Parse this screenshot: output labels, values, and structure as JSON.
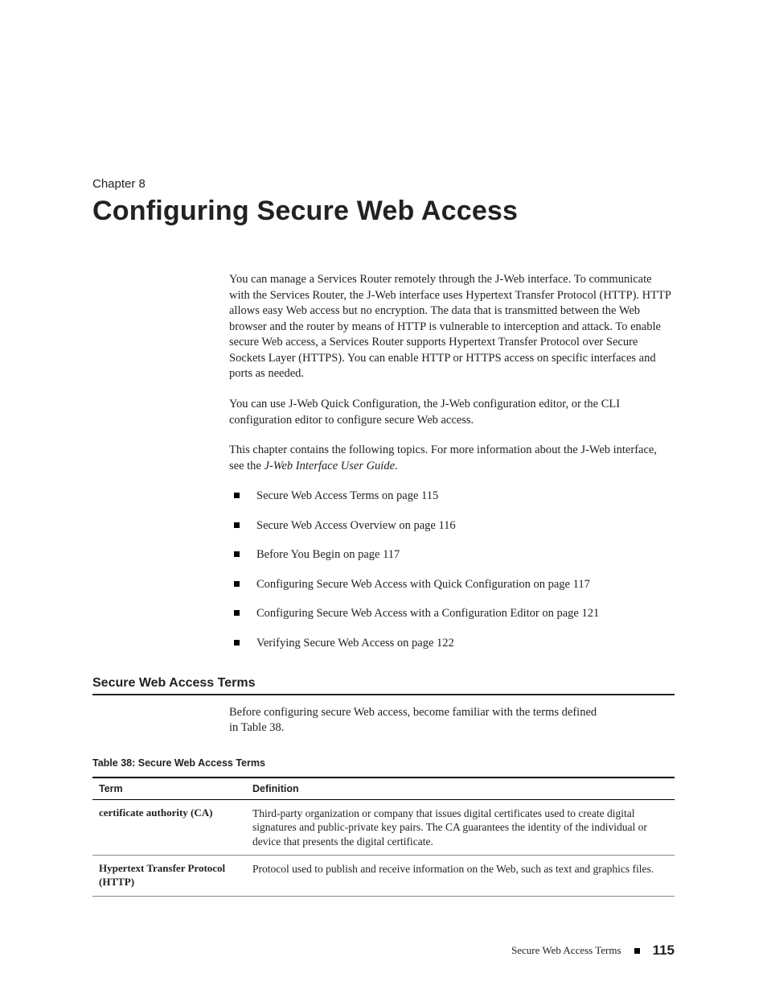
{
  "chapter": {
    "label": "Chapter 8",
    "title": "Configuring Secure Web Access"
  },
  "intro": {
    "p1": "You can manage a Services Router remotely through the J-Web interface. To communicate with the Services Router, the J-Web interface uses Hypertext Transfer Protocol (HTTP). HTTP allows easy Web access but no encryption. The data that is transmitted between the Web browser and the router by means of HTTP is vulnerable to interception and attack. To enable secure Web access, a Services Router supports Hypertext Transfer Protocol over Secure Sockets Layer (HTTPS). You can enable HTTP or HTTPS access on specific interfaces and ports as needed.",
    "p2": "You can use J-Web Quick Configuration, the J-Web configuration editor, or the CLI configuration editor to configure secure Web access.",
    "p3a": "This chapter contains the following topics. For more information about the J-Web interface, see the ",
    "p3_italic": "J-Web Interface User Guide",
    "p3b": "."
  },
  "topics": [
    "Secure Web Access Terms on page 115",
    "Secure Web Access Overview on page 116",
    "Before You Begin on page 117",
    "Configuring Secure Web Access with Quick Configuration on page 117",
    "Configuring Secure Web Access with a Configuration Editor on page 121",
    "Verifying Secure Web Access on page 122"
  ],
  "section": {
    "heading": "Secure Web Access Terms",
    "intro": "Before configuring secure Web access, become familiar with the terms defined in Table 38."
  },
  "table": {
    "caption": "Table 38:  Secure Web Access Terms",
    "head": {
      "c1": "Term",
      "c2": "Definition"
    },
    "rows": [
      {
        "term": "certificate authority (CA)",
        "def": "Third-party organization or company that issues digital certificates used to create digital signatures and public-private key pairs. The CA guarantees the identity of the individual or device that presents the digital certificate."
      },
      {
        "term": "Hypertext Transfer Protocol (HTTP)",
        "def": "Protocol used to publish and receive information on the Web, such as text and graphics files."
      }
    ]
  },
  "footer": {
    "section": "Secure Web Access Terms",
    "page": "115"
  }
}
